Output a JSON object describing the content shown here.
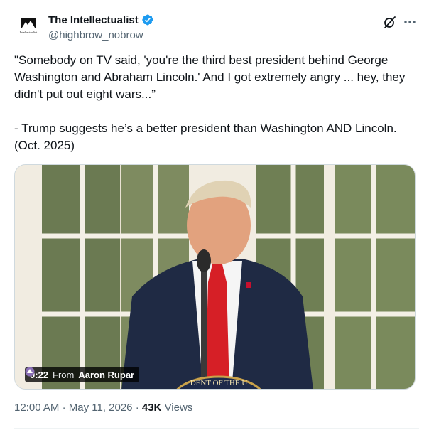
{
  "author": {
    "display_name": "The Intellectualist",
    "handle": "@highbrow_nobrow",
    "avatar_icon": "intellectualist-logo-icon",
    "avatar_text": "Intellectualist",
    "verified": true
  },
  "header_actions": {
    "grok_icon": "grok-icon",
    "more_icon": "more-dots-icon"
  },
  "tweet": {
    "text_line1": "\"Somebody on TV said, 'you're the third best president behind George Washington and Abraham Lincoln.' And I got extremely angry ... hey, they didn't put out eight wars...”",
    "text_line2": "- Trump suggests he’s a better president than Washington AND Lincoln. (Oct. 2025)"
  },
  "media": {
    "duration": "0:22",
    "from_label": "From",
    "source_author": "Aaron Rupar",
    "seal_text": "DENT OF THE U"
  },
  "meta": {
    "time": "12:00 AM",
    "separator": "·",
    "date": "May 11, 2026",
    "views_count": "43K",
    "views_label": "Views"
  },
  "colors": {
    "verified_blue": "#1d9bf0",
    "secondary_text": "#536471",
    "primary_text": "#0f1419"
  }
}
